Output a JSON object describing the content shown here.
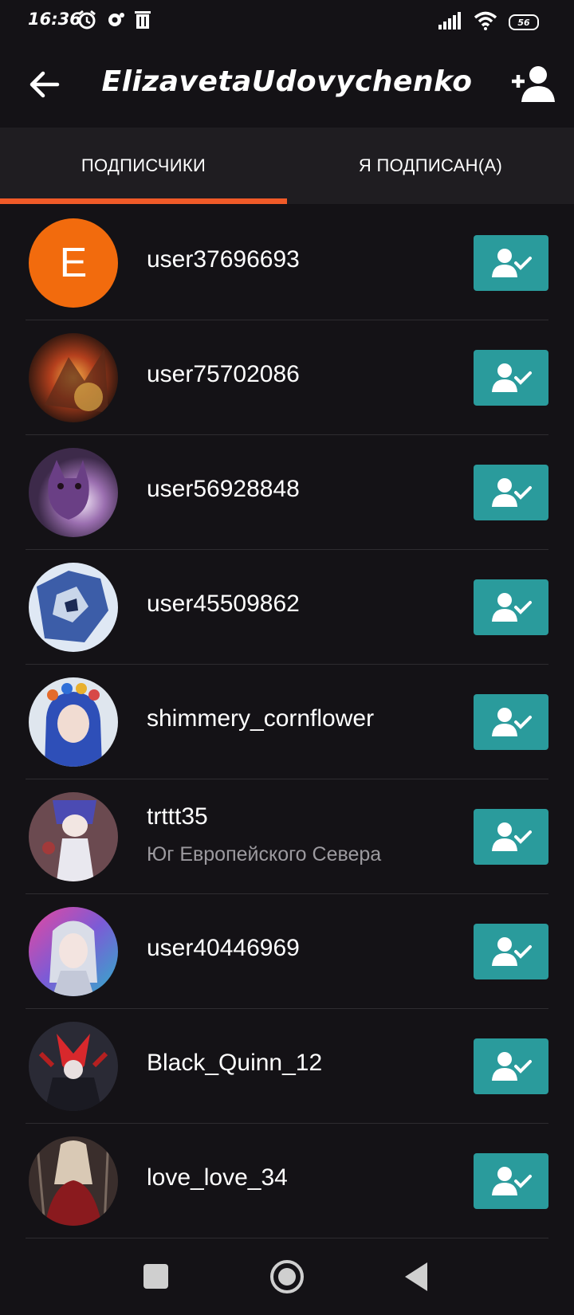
{
  "status_bar": {
    "time": "16:36",
    "battery": "56",
    "icons_left": [
      "alarm-icon",
      "notification-icon",
      "trash-icon"
    ],
    "icons_right": [
      "signal-icon",
      "wifi-icon",
      "battery-icon"
    ]
  },
  "header": {
    "title": "ElizavetaUdovychenko"
  },
  "tabs": [
    {
      "label": "ПОДПИСЧИКИ",
      "active": true
    },
    {
      "label": "Я ПОДПИСАН(А)",
      "active": false
    }
  ],
  "colors": {
    "accent": "#f05a28",
    "button": "#2a9b9c",
    "background": "#141216",
    "tab_bg": "#1f1d21",
    "letter_avatar": "#f26b0d"
  },
  "users": [
    {
      "name": "user37696693",
      "avatar_letter": "E",
      "subtitle": ""
    },
    {
      "name": "user75702086",
      "subtitle": ""
    },
    {
      "name": "user56928848",
      "subtitle": ""
    },
    {
      "name": "user45509862",
      "subtitle": ""
    },
    {
      "name": "shimmery_cornflower",
      "subtitle": ""
    },
    {
      "name": "trttt35",
      "subtitle": "Юг Европейского Севера"
    },
    {
      "name": "user40446969",
      "subtitle": ""
    },
    {
      "name": "Black_Quinn_12",
      "subtitle": ""
    },
    {
      "name": "love_love_34",
      "subtitle": ""
    }
  ],
  "nav": [
    "recent-apps-icon",
    "home-icon",
    "back-icon"
  ]
}
